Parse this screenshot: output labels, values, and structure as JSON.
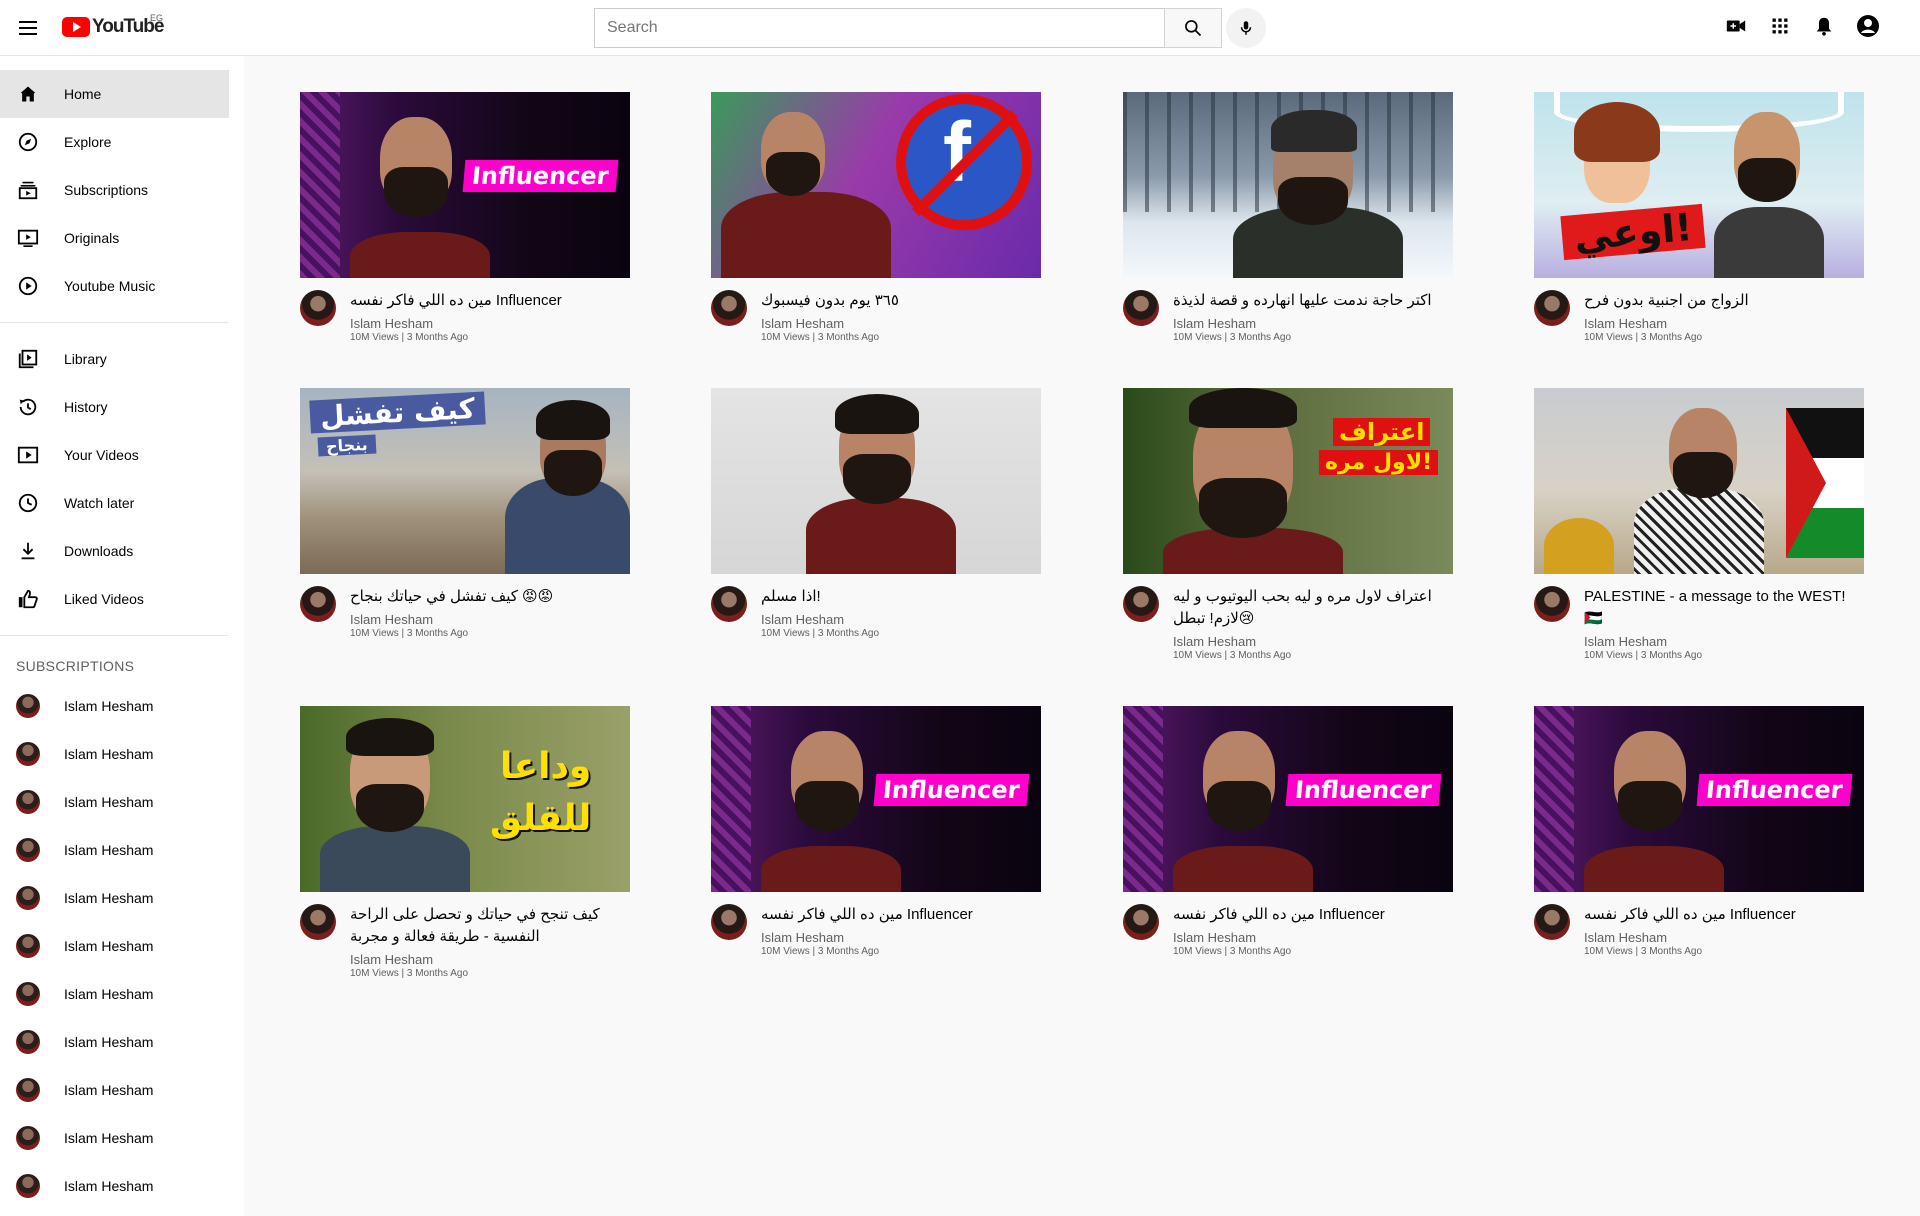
{
  "header": {
    "logo_text": "YouTube",
    "country_code": "EG",
    "search_placeholder": "Search"
  },
  "sidebar": {
    "main": [
      {
        "label": "Home",
        "icon": "home-icon",
        "active": true
      },
      {
        "label": "Explore",
        "icon": "compass-icon"
      },
      {
        "label": "Subscriptions",
        "icon": "subscriptions-icon"
      },
      {
        "label": "Originals",
        "icon": "originals-icon"
      },
      {
        "label": "Youtube Music",
        "icon": "music-icon"
      }
    ],
    "library": [
      {
        "label": "Library",
        "icon": "library-icon"
      },
      {
        "label": "History",
        "icon": "history-icon"
      },
      {
        "label": "Your Videos",
        "icon": "your-videos-icon"
      },
      {
        "label": "Watch later",
        "icon": "watch-later-icon"
      },
      {
        "label": "Downloads",
        "icon": "download-icon"
      },
      {
        "label": "Liked Videos",
        "icon": "like-icon"
      }
    ],
    "subscriptions_title": "SUBSCRIPTIONS",
    "subscriptions": [
      "Islam Hesham",
      "Islam Hesham",
      "Islam Hesham",
      "Islam Hesham",
      "Islam Hesham",
      "Islam Hesham",
      "Islam Hesham",
      "Islam Hesham",
      "Islam Hesham",
      "Islam Hesham",
      "Islam Hesham"
    ]
  },
  "videos": [
    {
      "title": "مين ده اللي فاكر نفسه Influencer",
      "channel": "Islam Hesham",
      "stats": "10M Views | 3 Months Ago",
      "thumb_text": "Influencer"
    },
    {
      "title": "٣٦٥ يوم بدون فيسبوك",
      "channel": "Islam Hesham",
      "stats": "10M Views | 3 Months Ago",
      "thumb_text": "f"
    },
    {
      "title": "اكتر حاجة ندمت عليها انهارده و قصة لذيذة",
      "channel": "Islam Hesham",
      "stats": "10M Views | 3 Months Ago",
      "thumb_text": ""
    },
    {
      "title": "الزواج من اجنبية بدون فرح",
      "channel": "Islam Hesham",
      "stats": "10M Views | 3 Months Ago",
      "thumb_text": "اوعي!"
    },
    {
      "title": "كيف تفشل في حياتك بنجاح 😡😡",
      "channel": "Islam Hesham",
      "stats": "10M Views | 3 Months Ago",
      "thumb_text": "كيف تفشل",
      "thumb_text2": "بنجاح"
    },
    {
      "title": "اذا مسلم!",
      "channel": "Islam Hesham",
      "stats": "10M Views | 3 Months Ago",
      "thumb_text": ""
    },
    {
      "title": "اعتراف لاول مره و ليه بحب اليوتيوب و ليه لازم! تبطل😢",
      "channel": "Islam Hesham",
      "stats": "10M Views | 3 Months Ago",
      "thumb_text": "اعتراف",
      "thumb_text2": "لاول مره!"
    },
    {
      "title": "PALESTINE - a message to the WEST! 🇵🇸",
      "channel": "Islam Hesham",
      "stats": "10M Views | 3 Months Ago",
      "thumb_text": ""
    },
    {
      "title": "كيف تنجح في حياتك و تحصل على الراحة النفسية - طريقة فعالة و مجربة",
      "channel": "Islam Hesham",
      "stats": "10M Views | 3 Months Ago",
      "thumb_text": "وداعا",
      "thumb_text2": "للقلق"
    },
    {
      "title": "مين ده اللي فاكر نفسه Influencer",
      "channel": "Islam Hesham",
      "stats": "10M Views | 3 Months Ago",
      "thumb_text": "Influencer"
    },
    {
      "title": "مين ده اللي فاكر نفسه Influencer",
      "channel": "Islam Hesham",
      "stats": "10M Views | 3 Months Ago",
      "thumb_text": "Influencer"
    },
    {
      "title": "مين ده اللي فاكر نفسه Influencer",
      "channel": "Islam Hesham",
      "stats": "10M Views | 3 Months Ago",
      "thumb_text": "Influencer"
    }
  ],
  "colors": {
    "brand_red": "#ff0000",
    "influencer_pink": "#ff00cc",
    "shirt_maroon": "#6b1a1a"
  }
}
